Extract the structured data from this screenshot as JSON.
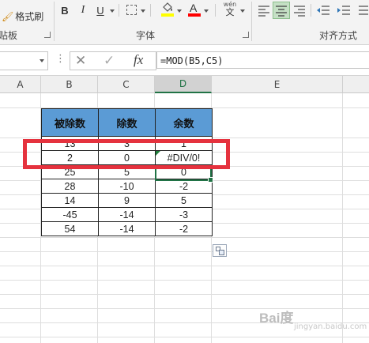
{
  "ribbon": {
    "clipboard": {
      "format_painter_label": "格式刷",
      "group_label": "贴板"
    },
    "font": {
      "bold_label": "B",
      "italic_label": "I",
      "underline_label": "U",
      "fill_color_letter": "",
      "font_color_letter": "A",
      "phonetic_label": "wén",
      "phonetic_char": "文",
      "group_label": "字体",
      "fill_color": "#ffff00",
      "font_color": "#ff0000"
    },
    "alignment": {
      "group_label": "对齐方式"
    }
  },
  "formula_bar": {
    "name_box_value": "",
    "cancel_icon": "x-icon",
    "enter_icon": "check-icon",
    "fx_label": "fx",
    "formula": "=MOD(B5,C5)"
  },
  "columns": [
    "A",
    "B",
    "C",
    "D",
    "E"
  ],
  "selected_column": "D",
  "table": {
    "headers": [
      "被除数",
      "除数",
      "余数"
    ],
    "header_color": "#5b9bd5",
    "rows": [
      [
        "13",
        "3",
        "1"
      ],
      [
        "2",
        "0",
        "#DIV/0!"
      ],
      [
        "25",
        "5",
        "0"
      ],
      [
        "28",
        "-10",
        "-2"
      ],
      [
        "14",
        "9",
        "5"
      ],
      [
        "-45",
        "-14",
        "-3"
      ],
      [
        "54",
        "-14",
        "-2"
      ]
    ]
  },
  "highlight_color": "#e5323e",
  "watermark": {
    "text": "Bai度",
    "sub": "jingyan.baidu.com"
  }
}
